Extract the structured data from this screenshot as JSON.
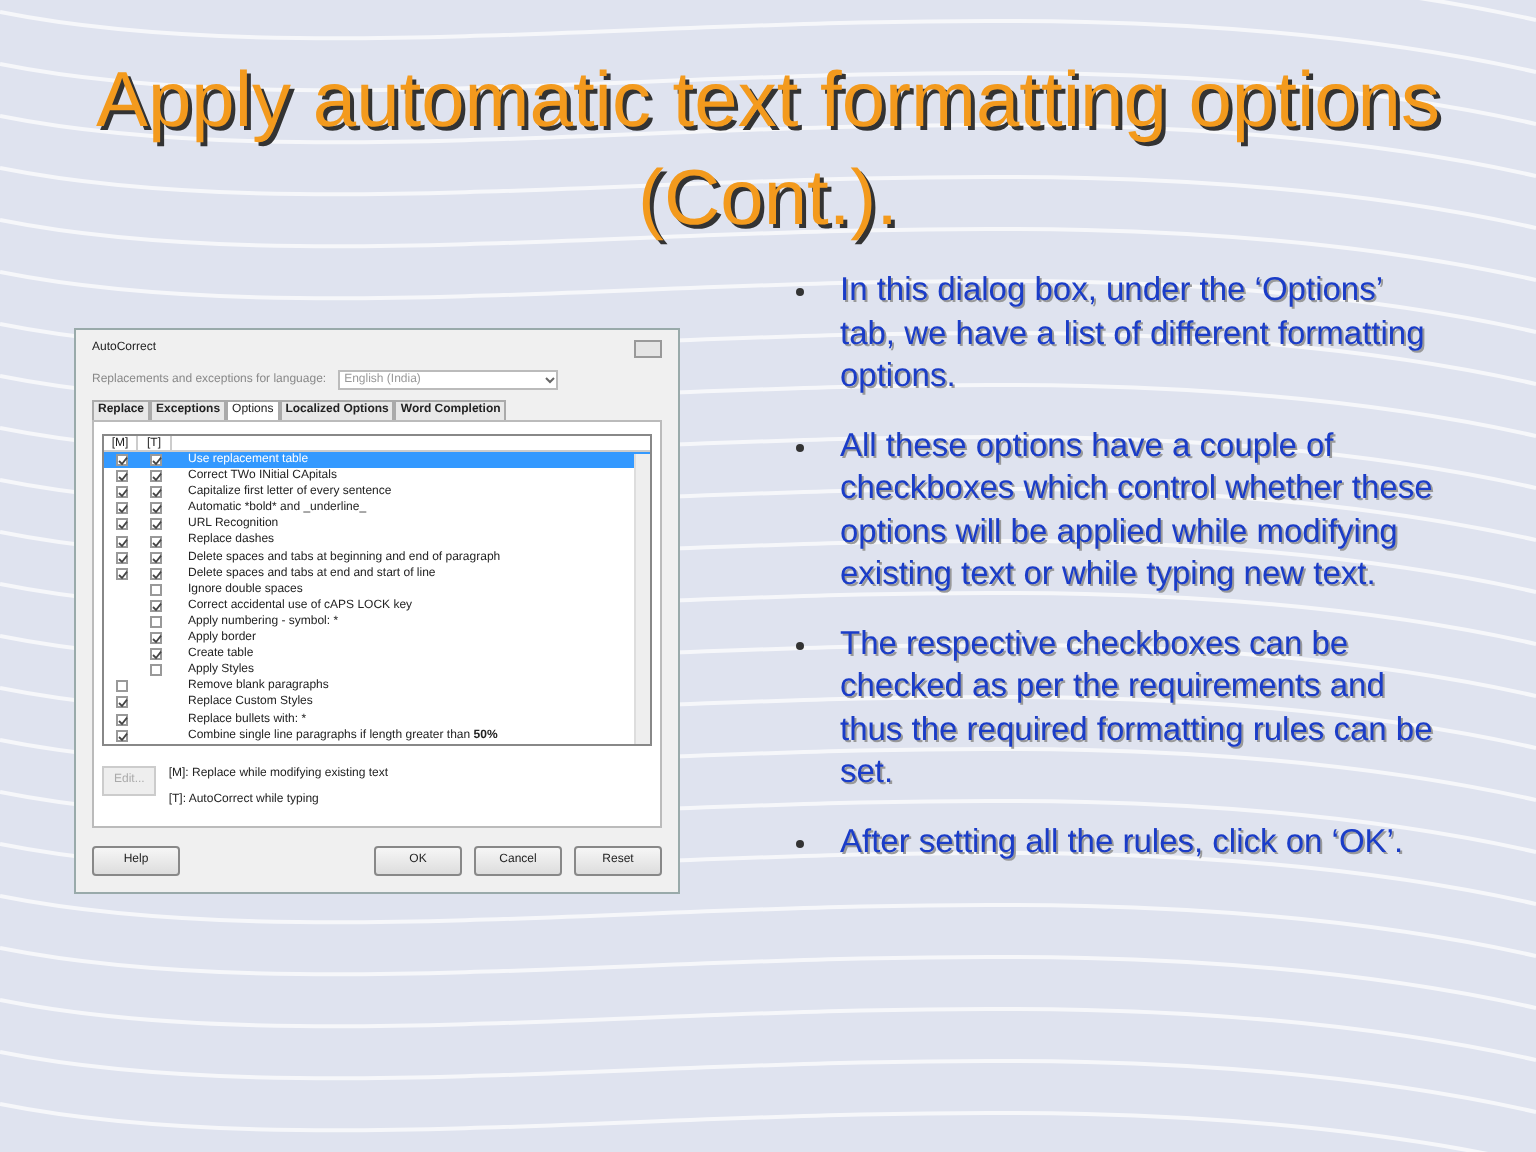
{
  "title": "Apply automatic text formatting options (Cont.).",
  "dialog": {
    "title": "AutoCorrect",
    "language_label": "Replacements and exceptions for language:",
    "language_value": "English (India)",
    "tabs": [
      {
        "label": "Replace",
        "selected": false
      },
      {
        "label": "Exceptions",
        "selected": false
      },
      {
        "label": "Options",
        "selected": true
      },
      {
        "label": "Localized Options",
        "selected": false
      },
      {
        "label": "Word Completion",
        "selected": false
      }
    ],
    "columns": [
      "[M]",
      "[T]"
    ],
    "options": [
      {
        "label": "Use replacement table",
        "m_checked": true,
        "t_checked": true,
        "selected": true
      },
      {
        "label": "Correct TWo INitial CApitals",
        "m_checked": true,
        "t_checked": true,
        "selected": false
      },
      {
        "label": "Capitalize first letter of every sentence",
        "m_checked": true,
        "t_checked": true,
        "selected": false
      },
      {
        "label": "Automatic *bold* and _underline_",
        "m_checked": true,
        "t_checked": true,
        "selected": false
      },
      {
        "label": "URL Recognition",
        "m_checked": true,
        "t_checked": true,
        "selected": false
      },
      {
        "label": "Replace dashes",
        "m_checked": true,
        "t_checked": true,
        "selected": false
      },
      {
        "label": "Delete spaces and tabs at beginning and end of paragraph",
        "m_checked": true,
        "t_checked": true,
        "selected": false
      },
      {
        "label": "Delete spaces and tabs at end and start of line",
        "m_checked": true,
        "t_checked": true,
        "selected": false
      },
      {
        "label": "Ignore double spaces",
        "t_checked": false,
        "selected": false
      },
      {
        "label": "Correct accidental use of cAPS LOCK key",
        "t_checked": true,
        "selected": false
      },
      {
        "label": "Apply numbering - symbol: *",
        "t_checked": false,
        "selected": false
      },
      {
        "label": "Apply border",
        "t_checked": true,
        "selected": false
      },
      {
        "label": "Create table",
        "t_checked": true,
        "selected": false
      },
      {
        "label": "Apply Styles",
        "t_checked": false,
        "selected": false
      },
      {
        "label": "Remove blank paragraphs",
        "m_checked": false,
        "selected": false
      },
      {
        "label": "Replace Custom Styles",
        "m_checked": true,
        "selected": false
      },
      {
        "label": "Replace bullets with: *",
        "m_checked": true,
        "selected": false
      },
      {
        "label": "Combine single line paragraphs if length greater than",
        "value": "50%",
        "m_checked": true,
        "selected": false
      }
    ],
    "edit_button": {
      "label": "Edit...",
      "disabled": true
    },
    "legend": [
      "[M]: Replace while modifying existing text",
      "[T]: AutoCorrect while typing"
    ],
    "buttons": [
      "Help",
      "OK",
      "Cancel",
      "Reset"
    ]
  },
  "bullets": [
    "In this dialog box, under the ‘Options’ tab, we have a list of different formatting options.",
    "All these options have a couple of checkboxes which control whether these options will be applied while modifying existing text or while typing new text.",
    "The respective checkboxes can be checked as per the requirements and thus the required formatting rules can be set.",
    "After setting all the rules, click on ‘OK’."
  ]
}
